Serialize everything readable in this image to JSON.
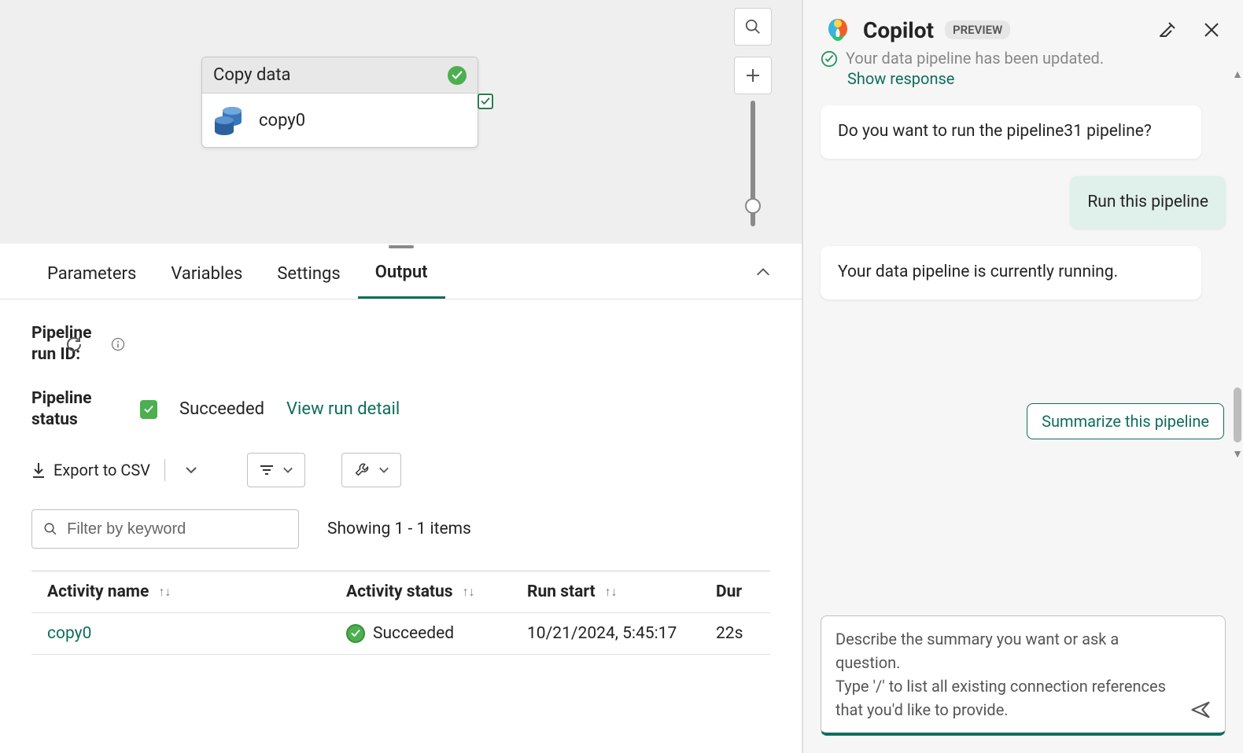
{
  "canvas": {
    "activityTitle": "Copy data",
    "activityName": "copy0"
  },
  "tabs": {
    "parameters": "Parameters",
    "variables": "Variables",
    "settings": "Settings",
    "output": "Output"
  },
  "output": {
    "runIdLabel": "Pipeline run ID:",
    "statusLabel": "Pipeline status",
    "statusValue": "Succeeded",
    "viewDetail": "View run detail",
    "exportCsv": "Export to CSV",
    "filterPlaceholder": "Filter by keyword",
    "showing": "Showing 1 - 1 items",
    "columns": {
      "activityName": "Activity name",
      "activityStatus": "Activity status",
      "runStart": "Run start",
      "duration": "Dur"
    },
    "rows": [
      {
        "name": "copy0",
        "status": "Succeeded",
        "start": "10/21/2024, 5:45:17",
        "duration": "22s"
      }
    ]
  },
  "copilot": {
    "title": "Copilot",
    "badge": "PREVIEW",
    "partialStatus": "Your data pipeline has been updated.",
    "showResponse": "Show response",
    "msg1": "Do you want to run the pipeline31 pipeline?",
    "userMsg": "Run this pipeline",
    "msg2": "Your data pipeline is currently running.",
    "suggestion": "Summarize this pipeline",
    "inputPlaceholder": "Describe the summary you want or ask a question.\nType '/' to list all existing connection references that you'd like to provide."
  }
}
